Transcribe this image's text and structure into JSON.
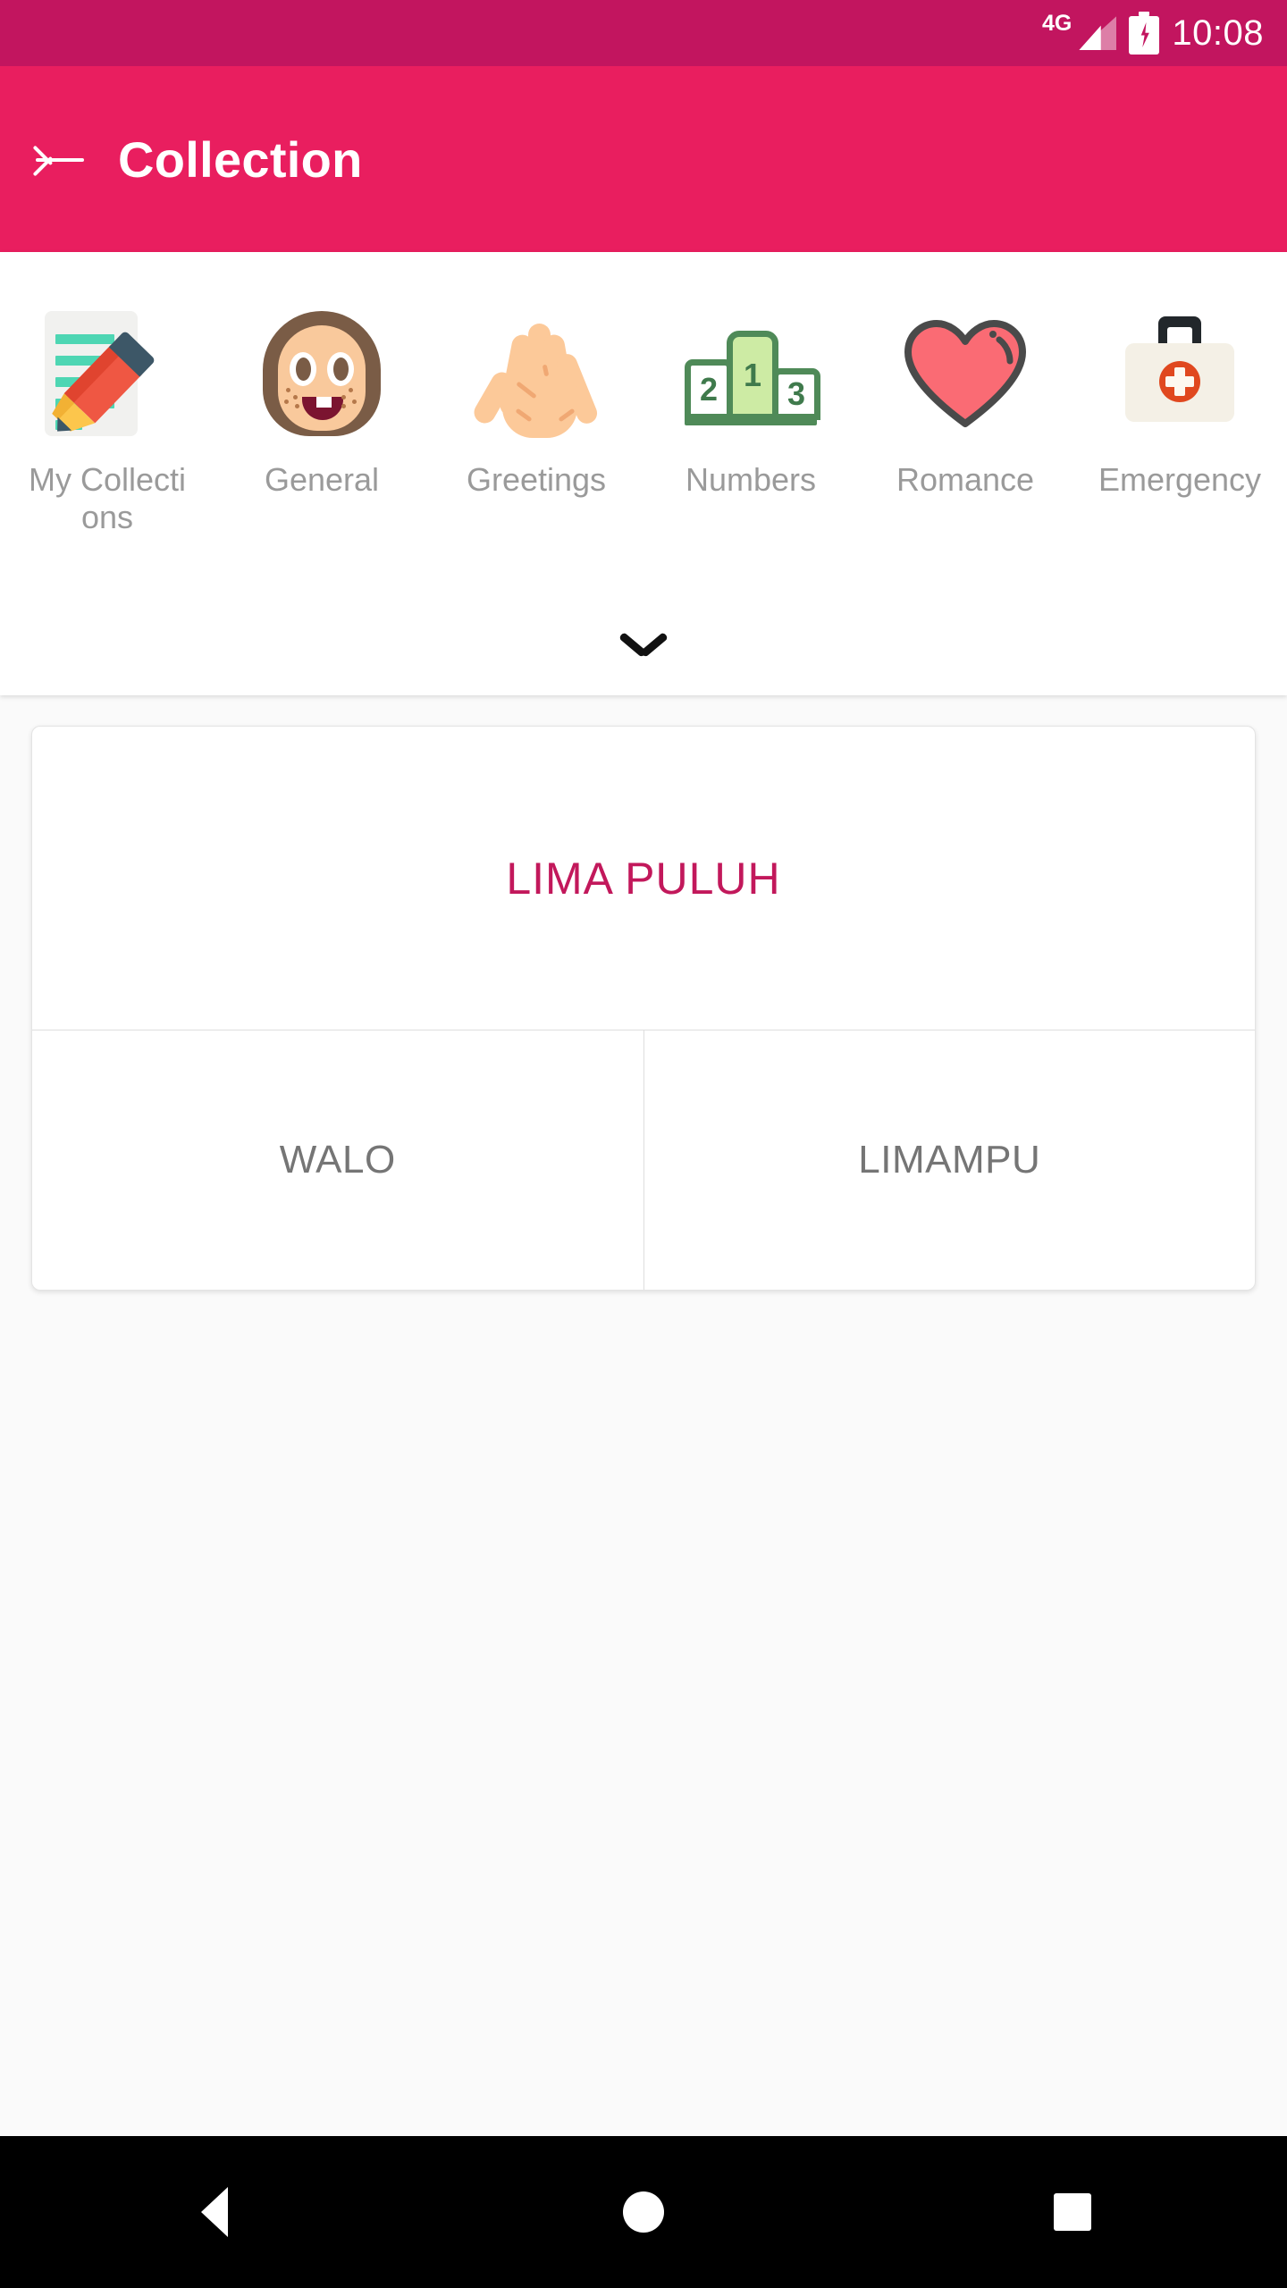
{
  "status_bar": {
    "network": "4G",
    "time": "10:08",
    "signal_icon": "signal-bars-icon",
    "battery_icon": "battery-charging-icon"
  },
  "app_bar": {
    "back_icon": "back-arrow-icon",
    "title": "Collection"
  },
  "categories": {
    "expand_icon": "chevron-down-icon",
    "items": [
      {
        "label": "My Collections",
        "icon": "memo-pencil-icon"
      },
      {
        "label": "General",
        "icon": "girl-face-icon"
      },
      {
        "label": "Greetings",
        "icon": "raised-hand-icon"
      },
      {
        "label": "Numbers",
        "icon": "podium-icon"
      },
      {
        "label": "Romance",
        "icon": "heart-icon"
      },
      {
        "label": "Emergency",
        "icon": "first-aid-kit-icon"
      }
    ]
  },
  "card": {
    "prompt": "LIMA PULUH",
    "prompt_color": "#c2185b",
    "options": [
      {
        "label": "WALO"
      },
      {
        "label": "LIMAMPU"
      }
    ]
  },
  "nav_bar": {
    "back": "nav-back-icon",
    "home": "nav-home-icon",
    "recents": "nav-recents-icon"
  },
  "colors": {
    "status_bar": "#c2155f",
    "app_bar": "#e91e5f",
    "accent": "#c2185b",
    "label_grey": "#9a9a9a",
    "option_grey": "#757575"
  }
}
